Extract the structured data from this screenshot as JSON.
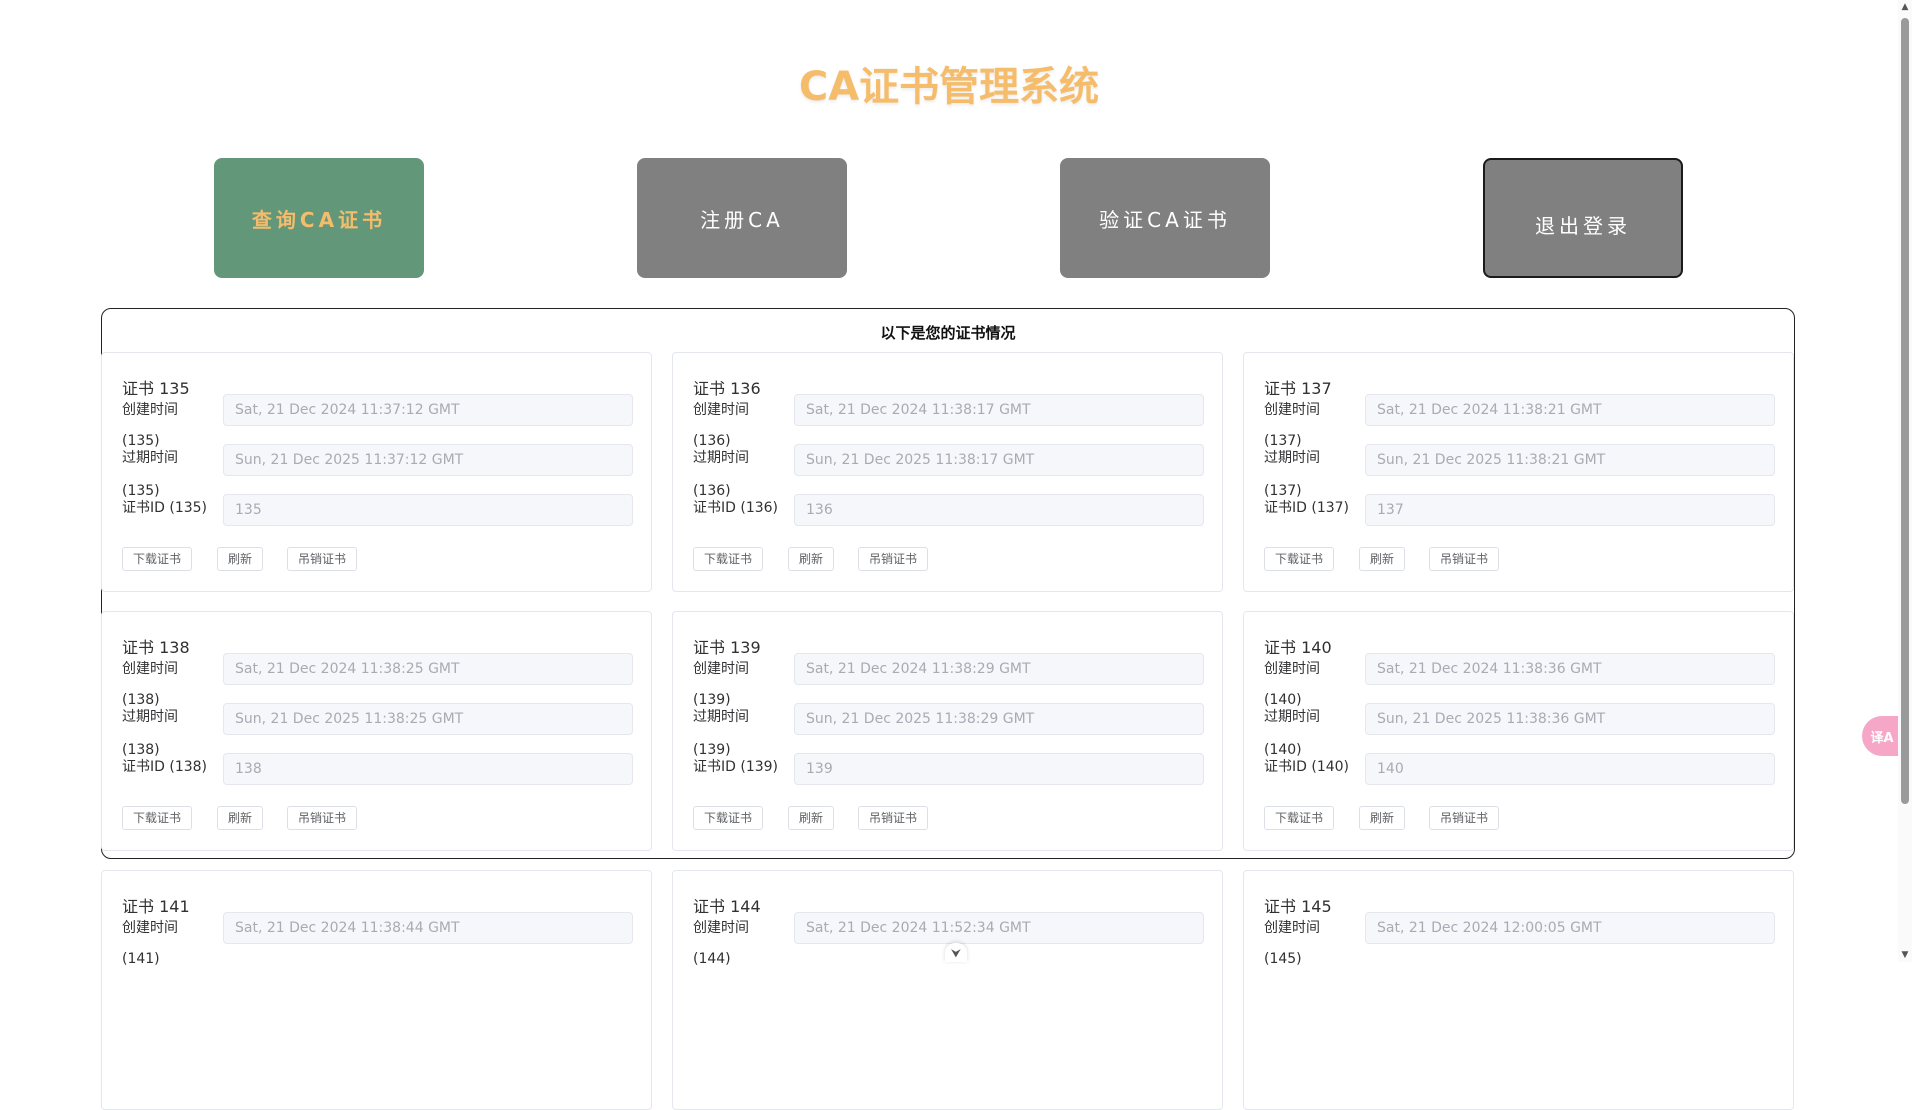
{
  "app": {
    "title": "CA证书管理系统"
  },
  "nav": [
    {
      "label": "查询CA证书"
    },
    {
      "label": "注册CA"
    },
    {
      "label": "验证CA证书"
    },
    {
      "label": "退出登录"
    }
  ],
  "panel": {
    "title": "以下是您的证书情况"
  },
  "labels": {
    "created": "创建时间",
    "expire": "过期时间",
    "download": "下载证书",
    "refresh": "刷新",
    "revoke": "吊销证书"
  },
  "certs": [
    {
      "title": "证书 135",
      "created": "Sat, 21 Dec 2024 11:37:12 GMT",
      "expire_label": "(135)\n过期时间",
      "expires": "Sun, 21 Dec 2025 11:37:12 GMT",
      "id_label": "(135)\n证书ID (135)",
      "id": "135"
    },
    {
      "title": "证书 136",
      "created": "Sat, 21 Dec 2024 11:38:17 GMT",
      "expire_label": "(136)\n过期时间",
      "expires": "Sun, 21 Dec 2025 11:38:17 GMT",
      "id_label": "(136)\n证书ID (136)",
      "id": "136"
    },
    {
      "title": "证书 137",
      "created": "Sat, 21 Dec 2024 11:38:21 GMT",
      "expire_label": "(137)\n过期时间",
      "expires": "Sun, 21 Dec 2025 11:38:21 GMT",
      "id_label": "(137)\n证书ID (137)",
      "id": "137"
    },
    {
      "title": "证书 138",
      "created": "Sat, 21 Dec 2024 11:38:25 GMT",
      "expire_label": "(138)\n过期时间",
      "expires": "Sun, 21 Dec 2025 11:38:25 GMT",
      "id_label": "(138)\n证书ID (138)",
      "id": "138"
    },
    {
      "title": "证书 139",
      "created": "Sat, 21 Dec 2024 11:38:29 GMT",
      "expire_label": "(139)\n过期时间",
      "expires": "Sun, 21 Dec 2025 11:38:29 GMT",
      "id_label": "(139)\n证书ID (139)",
      "id": "139"
    },
    {
      "title": "证书 140",
      "created": "Sat, 21 Dec 2024 11:38:36 GMT",
      "expire_label": "(140)\n过期时间",
      "expires": "Sun, 21 Dec 2025 11:38:36 GMT",
      "id_label": "(140)\n证书ID (140)",
      "id": "140"
    },
    {
      "title": "证书 141",
      "created": "Sat, 21 Dec 2024 11:38:44 GMT",
      "expire_label": "(141)"
    },
    {
      "title": "证书 144",
      "created": "Sat, 21 Dec 2024 11:52:34 GMT",
      "expire_label": "(144)"
    },
    {
      "title": "证书 145",
      "created": "Sat, 21 Dec 2024 12:00:05 GMT",
      "expire_label": "(145)"
    }
  ],
  "extras": {
    "translate_badge": "译A"
  },
  "colors": {
    "title": "#f5bd6b",
    "active_nav": "#63977a",
    "nav": "#808080",
    "input_bg": "#f5f7fa"
  }
}
